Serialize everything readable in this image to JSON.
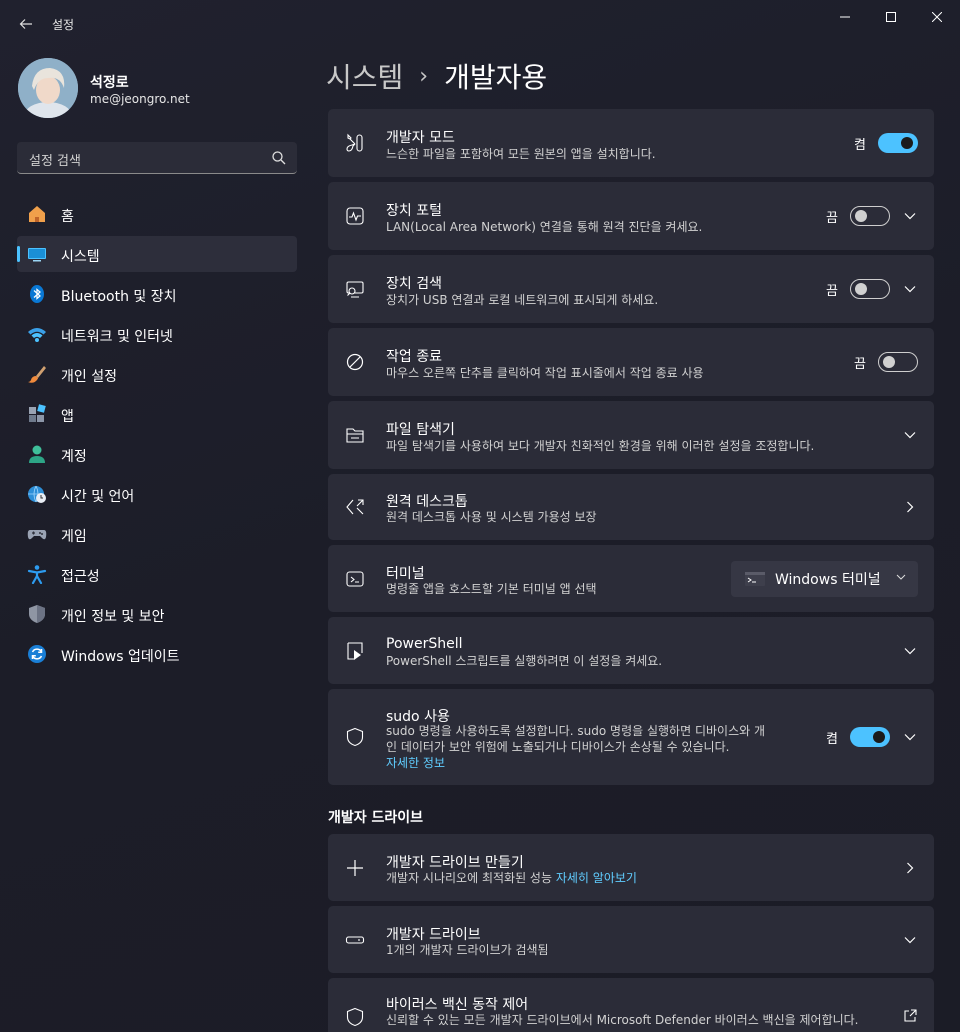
{
  "window": {
    "title": "설정"
  },
  "profile": {
    "name": "석정로",
    "email": "me@jeongro.net"
  },
  "search": {
    "placeholder": "설정 검색"
  },
  "sidebar": {
    "items": [
      {
        "label": "홈",
        "icon": "home-icon"
      },
      {
        "label": "시스템",
        "icon": "system-icon",
        "active": true
      },
      {
        "label": "Bluetooth 및 장치",
        "icon": "bluetooth-icon"
      },
      {
        "label": "네트워크 및 인터넷",
        "icon": "wifi-icon"
      },
      {
        "label": "개인 설정",
        "icon": "brush-icon"
      },
      {
        "label": "앱",
        "icon": "apps-icon"
      },
      {
        "label": "계정",
        "icon": "account-icon"
      },
      {
        "label": "시간 및 언어",
        "icon": "globe-clock-icon"
      },
      {
        "label": "게임",
        "icon": "gamepad-icon"
      },
      {
        "label": "접근성",
        "icon": "accessibility-icon"
      },
      {
        "label": "개인 정보 및 보안",
        "icon": "shield-icon"
      },
      {
        "label": "Windows 업데이트",
        "icon": "update-icon"
      }
    ]
  },
  "breadcrumb": {
    "parent": "시스템",
    "separator": "›",
    "current": "개발자용"
  },
  "settings": {
    "dev_mode": {
      "title": "개발자 모드",
      "desc": "느슨한 파일을 포함하여 모든 원본의 앱을 설치합니다.",
      "state": "켬",
      "on": true
    },
    "device_portal": {
      "title": "장치 포털",
      "desc": "LAN(Local Area Network) 연결을 통해 원격 진단을 켜세요.",
      "state": "끔",
      "on": false
    },
    "device_discovery": {
      "title": "장치 검색",
      "desc": "장치가 USB 연결과 로컬 네트워크에 표시되게 하세요.",
      "state": "끔",
      "on": false
    },
    "end_task": {
      "title": "작업 종료",
      "desc": "마우스 오른쪽 단추를 클릭하여 작업 표시줄에서 작업 종료 사용",
      "state": "끔",
      "on": false
    },
    "file_explorer": {
      "title": "파일 탐색기",
      "desc": "파일 탐색기를 사용하여 보다 개발자 친화적인 환경을 위해 이러한 설정을 조정합니다."
    },
    "remote_desktop": {
      "title": "원격 데스크톱",
      "desc": "원격 데스크톱 사용 및 시스템 가용성 보장"
    },
    "terminal": {
      "title": "터미널",
      "desc": "명령줄 앱을 호스트할 기본 터미널 앱 선택",
      "selected": "Windows 터미널"
    },
    "powershell": {
      "title": "PowerShell",
      "desc": "PowerShell 스크립트를 실행하려면 이 설정을 켜세요."
    },
    "sudo": {
      "title": "sudo 사용",
      "desc_line1": "sudo 명령을 사용하도록 설정합니다. sudo 명령을 실행하면 디바이스와 개",
      "desc_line2": "인 데이터가 보안 위험에 노출되거나 디바이스가 손상될 수 있습니다.",
      "link": "자세한 정보",
      "state": "켬",
      "on": true
    }
  },
  "dev_drive": {
    "section_title": "개발자 드라이브",
    "create": {
      "title": "개발자 드라이브 만들기",
      "desc": "개발자 시나리오에 최적화된 성능",
      "link": "자세히 알아보기"
    },
    "drives": {
      "title": "개발자 드라이브",
      "desc": "1개의 개발자 드라이브가 검색됨"
    },
    "antivirus": {
      "title": "바이러스 백신 동작 제어",
      "desc": "신뢰할 수 있는 모든 개발자 드라이브에서 Microsoft Defender 바이러스 백신을 제어합니다."
    }
  },
  "colors": {
    "accent": "#4cc2ff",
    "link": "#60cdff",
    "card": "#2b2c38",
    "background": "#1e1f2b"
  }
}
